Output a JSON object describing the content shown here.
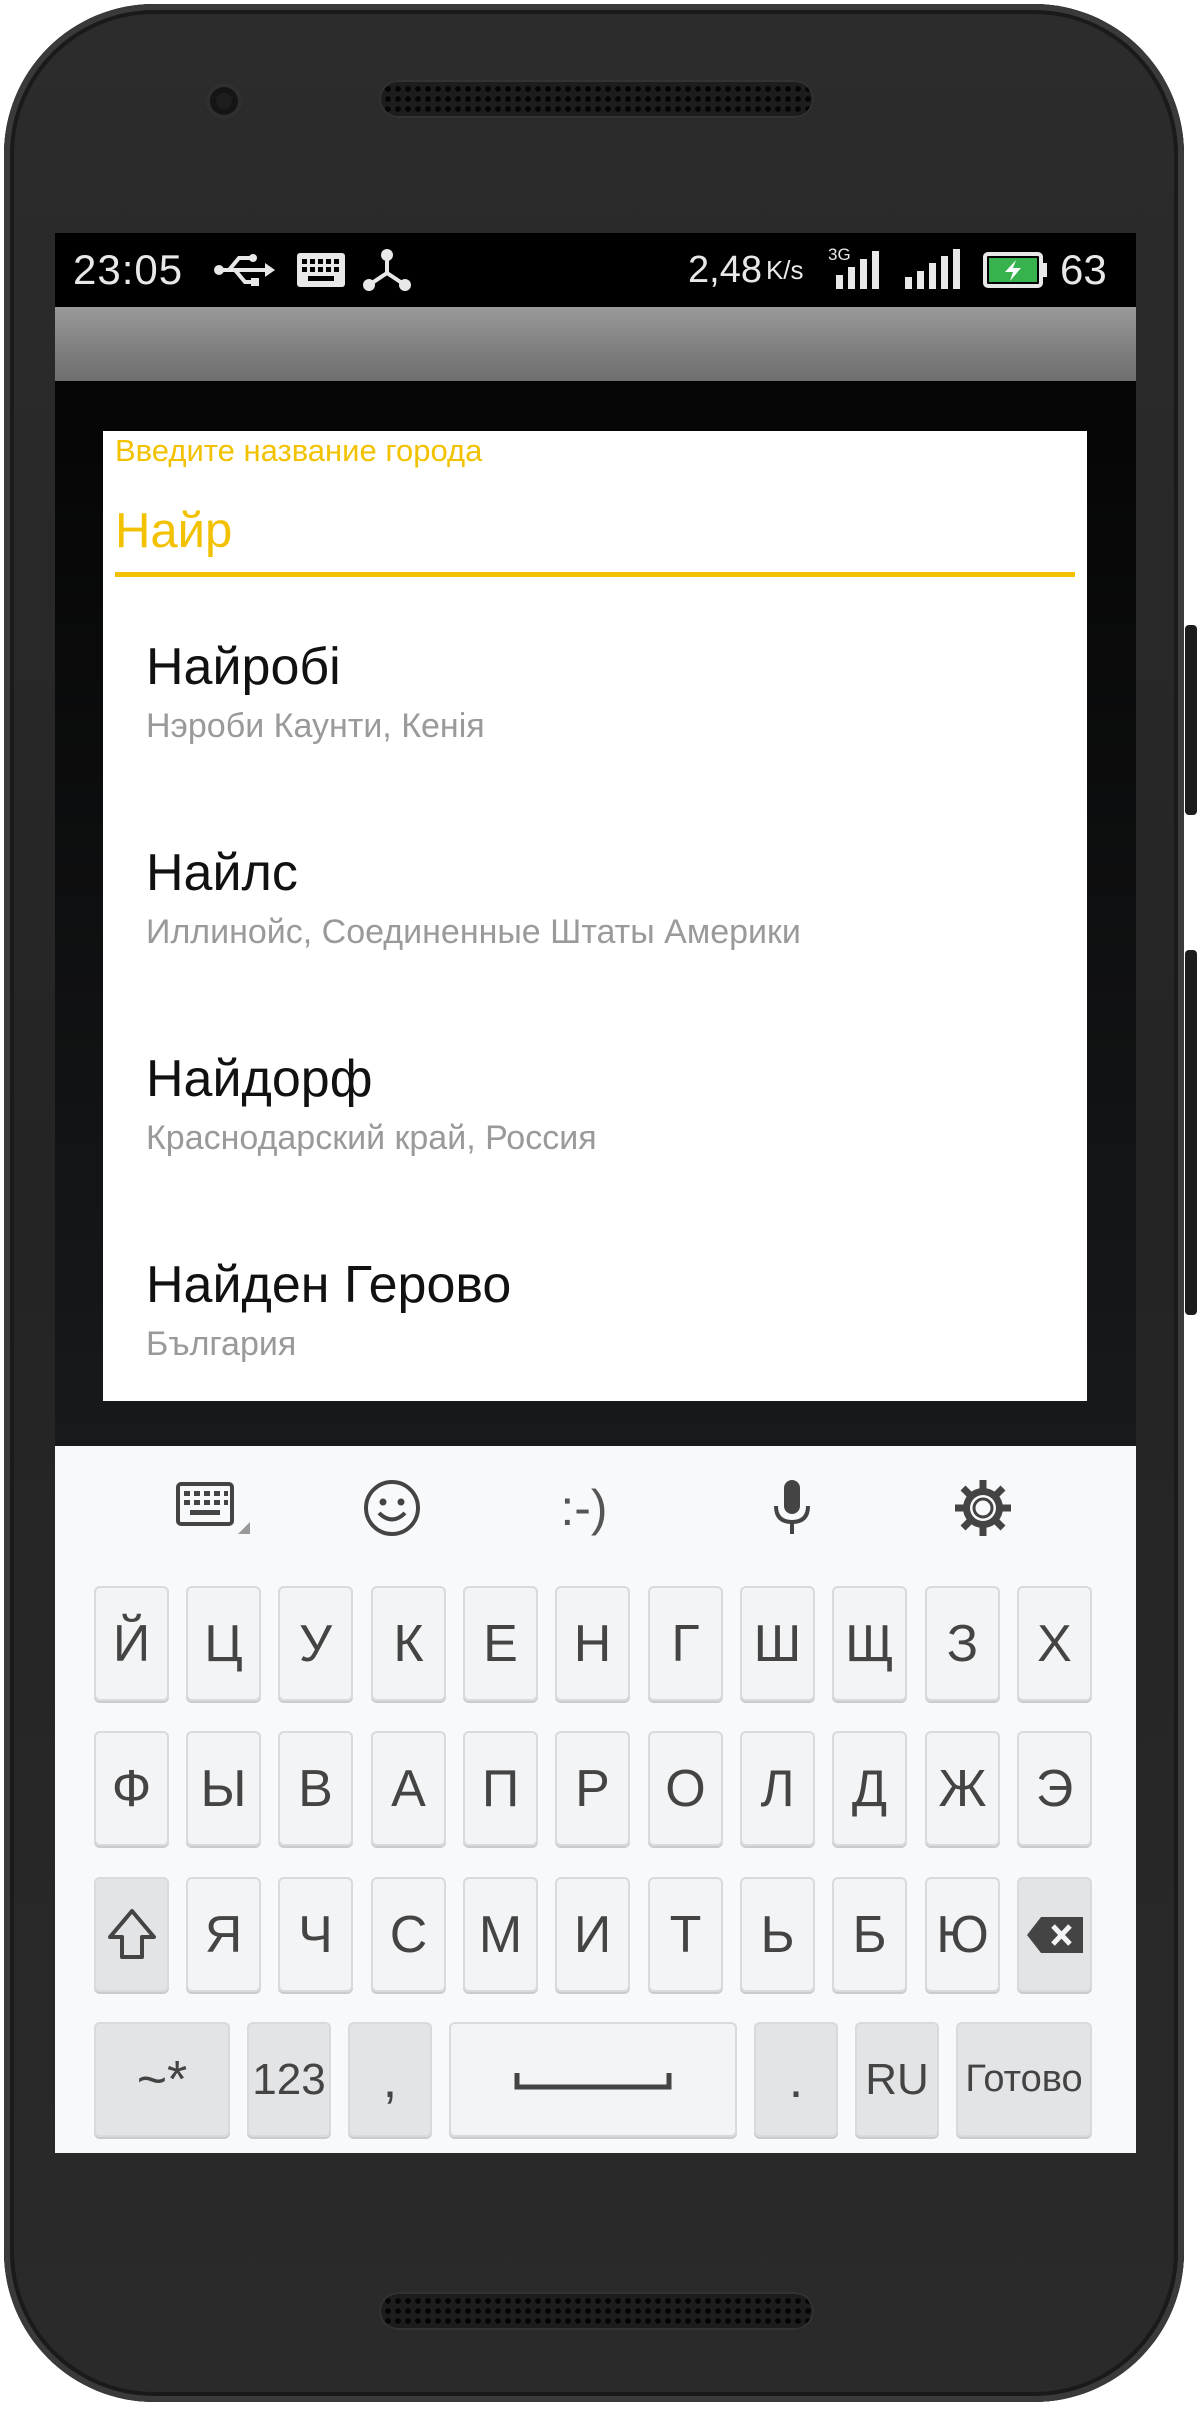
{
  "status_bar": {
    "time": "23:05",
    "speed": "2,48",
    "speed_unit": "K/s",
    "network_type": "3G",
    "battery_level": "63",
    "icons": [
      "usb-icon",
      "keyboard-icon",
      "share-icon",
      "signal-3g-icon",
      "signal-icon",
      "battery-charging-icon"
    ]
  },
  "dialog": {
    "hint": "Введите название города",
    "input_value": "Найр",
    "accent_color": "#f2c200",
    "suggestions": [
      {
        "name": "Найробі",
        "region": "Нэроби Каунти, Кенія"
      },
      {
        "name": "Найлс",
        "region": "Иллинойс, Соединенные Штаты Америки"
      },
      {
        "name": "Найдорф",
        "region": "Краснодарский край, Россия"
      },
      {
        "name": "Найден Герово",
        "region": "България"
      }
    ]
  },
  "keyboard": {
    "toolbar": {
      "emoticon": ":-)",
      "icons": [
        "keyboard-switch-icon",
        "emoji-icon",
        "mic-icon",
        "settings-icon"
      ]
    },
    "rows": [
      [
        "Й",
        "Ц",
        "У",
        "К",
        "Е",
        "Н",
        "Г",
        "Ш",
        "Щ",
        "З",
        "Х"
      ],
      [
        "Ф",
        "Ы",
        "В",
        "А",
        "П",
        "Р",
        "О",
        "Л",
        "Д",
        "Ж",
        "Э"
      ],
      [
        "Я",
        "Ч",
        "С",
        "М",
        "И",
        "Т",
        "Ь",
        "Б",
        "Ю"
      ]
    ],
    "bottom": {
      "symbols": "~*",
      "numbers": "123",
      "comma": ",",
      "period": ".",
      "language": "RU",
      "done": "Готово"
    }
  }
}
